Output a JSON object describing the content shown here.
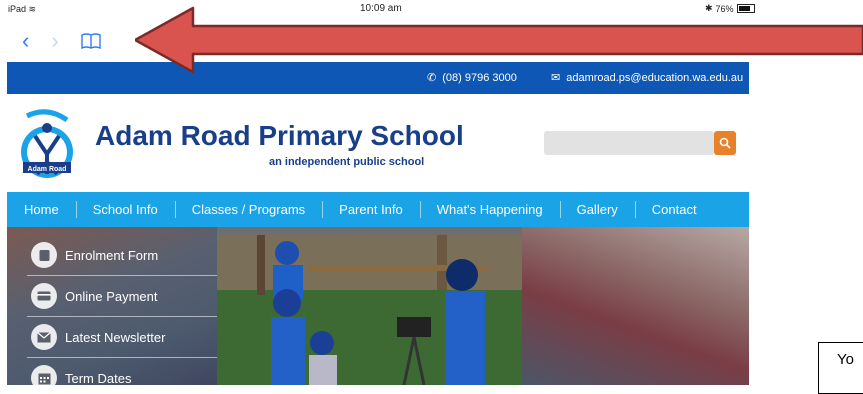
{
  "status_bar": {
    "device": "iPad",
    "time": "10:09 am",
    "battery": "76%"
  },
  "safari": {
    "back_label": "‹",
    "forward_label": "›"
  },
  "site": {
    "phone": "(08) 9796 3000",
    "email": "adamroad.ps@education.wa.edu.au",
    "logo_text": "Adam Road",
    "name": "Adam Road Primary School",
    "tagline": "an independent public school",
    "menu": [
      "Home",
      "School Info",
      "Classes / Programs",
      "Parent Info",
      "What's Happening",
      "Gallery",
      "Contact"
    ],
    "side_menu": [
      {
        "label": "Enrolment Form",
        "icon": "form-icon"
      },
      {
        "label": "Online Payment",
        "icon": "card-icon"
      },
      {
        "label": "Latest Newsletter",
        "icon": "envelope-icon"
      },
      {
        "label": "Term Dates",
        "icon": "calendar-icon"
      }
    ]
  },
  "annotation": {
    "arrow_color": "#d9534f",
    "note_text": "Yo"
  },
  "colors": {
    "topbar": "#0e57b4",
    "menubar": "#1aa3e6",
    "search_button": "#e8822a",
    "brand_text": "#1a3f8a",
    "ios_blue": "#2f7df6"
  }
}
